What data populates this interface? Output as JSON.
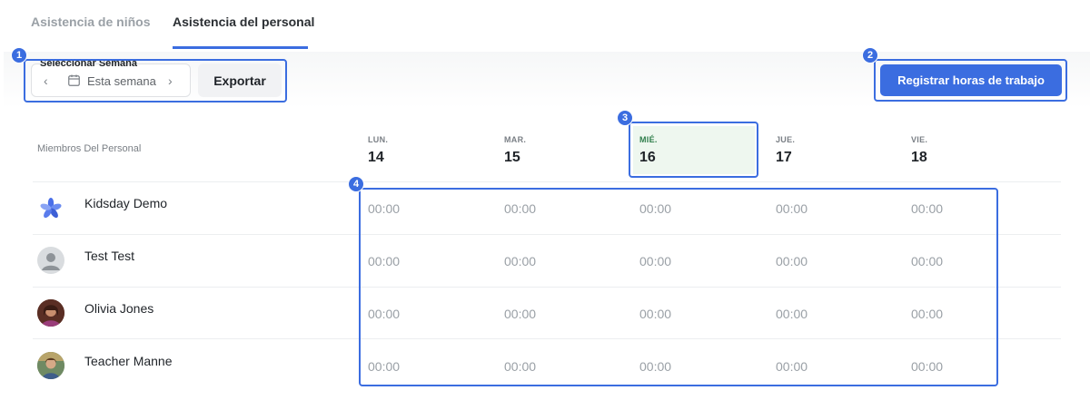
{
  "tabs": [
    {
      "label": "Asistencia de niños",
      "active": false
    },
    {
      "label": "Asistencia del personal",
      "active": true
    }
  ],
  "toolbar": {
    "week_label": "Seleccionar Semana",
    "week_value": "Esta semana",
    "export_label": "Exportar",
    "register_label": "Registrar horas de trabajo"
  },
  "table": {
    "member_header": "Miembros Del Personal",
    "days": [
      {
        "abbr": "LUN.",
        "num": "14",
        "today": false
      },
      {
        "abbr": "MAR.",
        "num": "15",
        "today": false
      },
      {
        "abbr": "MIÉ.",
        "num": "16",
        "today": true
      },
      {
        "abbr": "JUE.",
        "num": "17",
        "today": false
      },
      {
        "abbr": "VIE.",
        "num": "18",
        "today": false
      }
    ],
    "members": [
      {
        "name": "Kidsday Demo",
        "hours": [
          "00:00",
          "00:00",
          "00:00",
          "00:00",
          "00:00"
        ],
        "avatar": "kidsday-logo-icon"
      },
      {
        "name": "Test Test",
        "hours": [
          "00:00",
          "00:00",
          "00:00",
          "00:00",
          "00:00"
        ],
        "avatar": "default-user-icon"
      },
      {
        "name": "Olivia Jones",
        "hours": [
          "00:00",
          "00:00",
          "00:00",
          "00:00",
          "00:00"
        ],
        "avatar": "photo-avatar"
      },
      {
        "name": "Teacher Manne",
        "hours": [
          "00:00",
          "00:00",
          "00:00",
          "00:00",
          "00:00"
        ],
        "avatar": "photo-avatar"
      }
    ]
  },
  "annotations": [
    "1",
    "2",
    "3",
    "4"
  ],
  "colors": {
    "accent": "#3b6de0",
    "today_bg": "#eef7ef",
    "today_text": "#2e7d4a"
  }
}
